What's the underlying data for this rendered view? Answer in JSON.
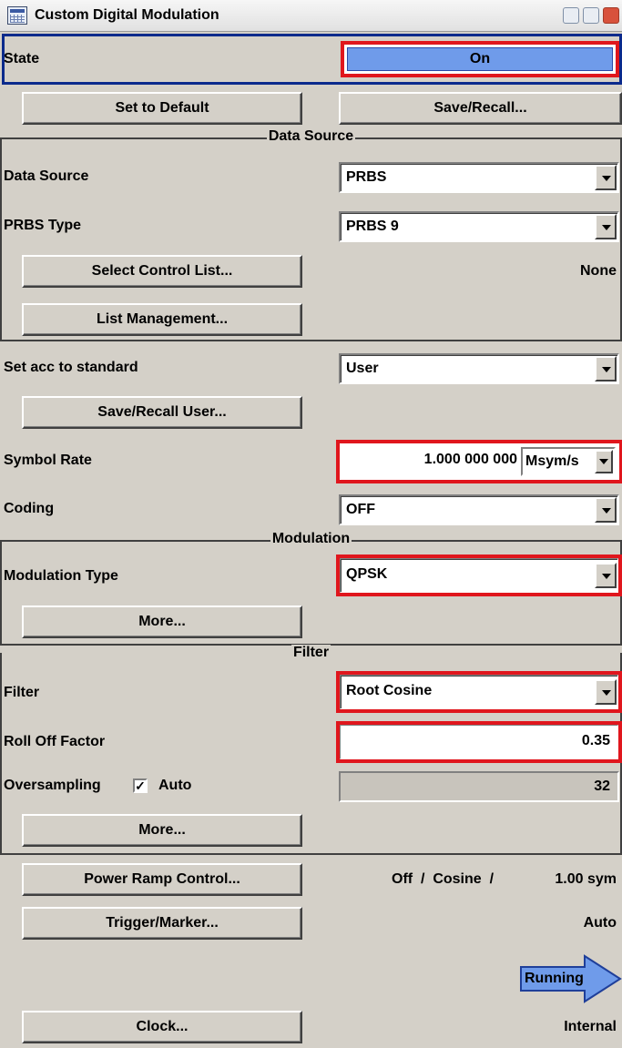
{
  "window": {
    "title": "Custom Digital Modulation"
  },
  "state": {
    "label": "State",
    "value": "On"
  },
  "top_buttons": {
    "set_default": "Set to Default",
    "save_recall": "Save/Recall..."
  },
  "data_source": {
    "section_title": "Data Source",
    "data_source_label": "Data Source",
    "data_source_value": "PRBS",
    "prbs_type_label": "PRBS Type",
    "prbs_type_value": "PRBS 9",
    "select_control_list": "Select Control List...",
    "control_list_value": "None",
    "list_management": "List Management..."
  },
  "standard": {
    "label": "Set acc to standard",
    "value": "User",
    "save_recall_user": "Save/Recall User...",
    "symbol_rate_label": "Symbol Rate",
    "symbol_rate_value": "1.000 000 000",
    "symbol_rate_unit": "Msym/s",
    "coding_label": "Coding",
    "coding_value": "OFF"
  },
  "modulation": {
    "section_title": "Modulation",
    "type_label": "Modulation Type",
    "type_value": "QPSK",
    "more": "More..."
  },
  "filter": {
    "section_title": "Filter",
    "filter_label": "Filter",
    "filter_value": "Root Cosine",
    "roll_off_label": "Roll Off Factor",
    "roll_off_value": "0.35",
    "oversampling_label": "Oversampling",
    "auto_label": "Auto",
    "oversampling_value": "32",
    "more": "More..."
  },
  "bottom": {
    "power_ramp": "Power Ramp Control...",
    "power_ramp_status": "Off  /  Cosine  /",
    "power_ramp_sym": "1.00 sym",
    "trigger_marker": "Trigger/Marker...",
    "trigger_status": "Auto",
    "running": "Running",
    "clock": "Clock...",
    "clock_status": "Internal"
  },
  "colors": {
    "highlight": "#e0161d",
    "state_on": "#6f9bea",
    "running": "#6f9bea",
    "panel": "#d4d0c8"
  }
}
